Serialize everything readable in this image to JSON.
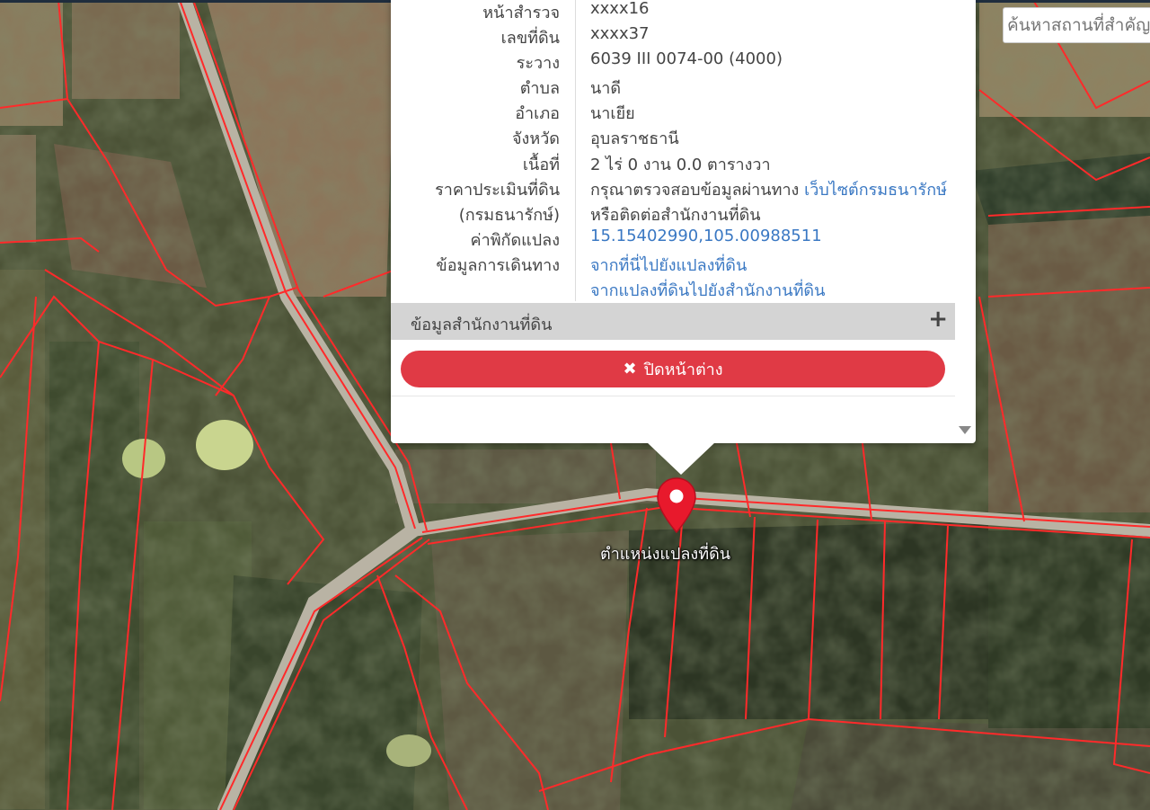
{
  "search": {
    "placeholder": "ค้นหาสถานที่สำคัญ"
  },
  "popup": {
    "rows": [
      {
        "label": "หน้าสำรวจ",
        "value": "xxxx16"
      },
      {
        "label": "เลขที่ดิน",
        "value": "xxxx37"
      },
      {
        "label": "ระวาง",
        "value": "6039 III 0074-00 (4000)"
      },
      {
        "label": "ตำบล",
        "value": "นาดี"
      },
      {
        "label": "อำเภอ",
        "value": "นาเยีย"
      },
      {
        "label": "จังหวัด",
        "value": "อุบลราชธานี"
      },
      {
        "label": "เนื้อที่",
        "value": "2 ไร่ 0 งาน 0.0 ตารางวา"
      },
      {
        "label": "ราคาประเมินที่ดิน",
        "value": "กรุณาตรวจสอบข้อมูลผ่านทาง",
        "link": "เว็บไซต์กรมธนารักษ์"
      },
      {
        "label": "(กรมธนารักษ์)",
        "value": "หรือติดต่อสำนักงานที่ดิน"
      },
      {
        "label": "ค่าพิกัดแปลง",
        "link": "15.15402990,105.00988511"
      },
      {
        "label": "ข้อมูลการเดินทาง",
        "link": "จากที่นี่ไปยังแปลงที่ดิน"
      },
      {
        "label": "",
        "link": "จากแปลงที่ดินไปยังสำนักงานที่ดิน"
      }
    ],
    "section_label": "ข้อมูลสำนักงานที่ดิน",
    "section_icon": "plus-icon",
    "close_label": "ปิดหน้าต่าง",
    "close_icon": "close-x-icon"
  },
  "marker": {
    "label": "ตำแหน่งแปลงที่ดิน",
    "icon": "map-pin-icon",
    "color": "#e8192c"
  },
  "colors": {
    "parcel_line": "#ff2a2a",
    "close_button": "#e03a45",
    "link": "#3a78c3"
  }
}
